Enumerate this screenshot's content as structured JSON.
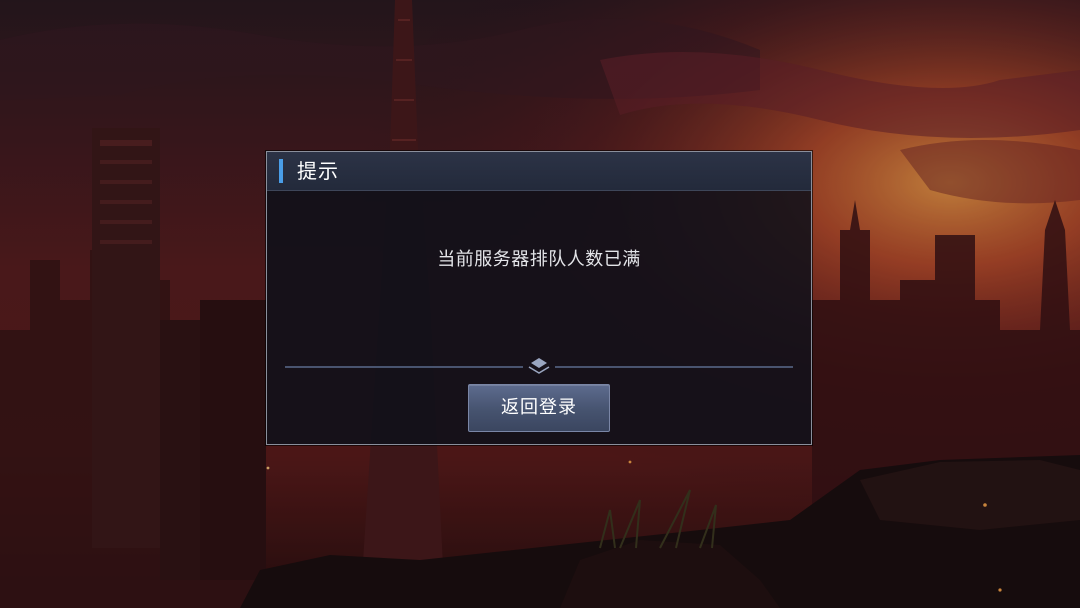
{
  "dialog": {
    "title": "提示",
    "message": "当前服务器排队人数已满",
    "return_button_label": "返回登录"
  },
  "colors": {
    "accent": "#4a9ee8",
    "sky_glow": "#e0703a",
    "button_bg": "#4b5874"
  },
  "icons": {
    "divider_ornament": "diamond-chevron-icon"
  }
}
